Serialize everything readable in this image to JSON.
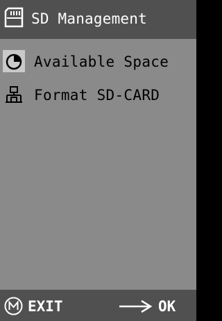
{
  "header": {
    "icon": "sd-card-icon",
    "title": "SD Management"
  },
  "menu": {
    "items": [
      {
        "icon": "pie-chart-icon",
        "label": "Available Space",
        "selected": true
      },
      {
        "icon": "network-format-icon",
        "label": "Format SD-CARD",
        "selected": false
      }
    ]
  },
  "footer": {
    "exit_key_icon": "m-circle-icon",
    "exit_label": "EXIT",
    "ok_key_icon": "right-arrow-icon",
    "ok_label": "OK"
  },
  "colors": {
    "background": "#8a8a8a",
    "bar": "#505050",
    "selection": "#c9c9c9",
    "bar_text": "#ffffff",
    "menu_text": "#000000"
  }
}
